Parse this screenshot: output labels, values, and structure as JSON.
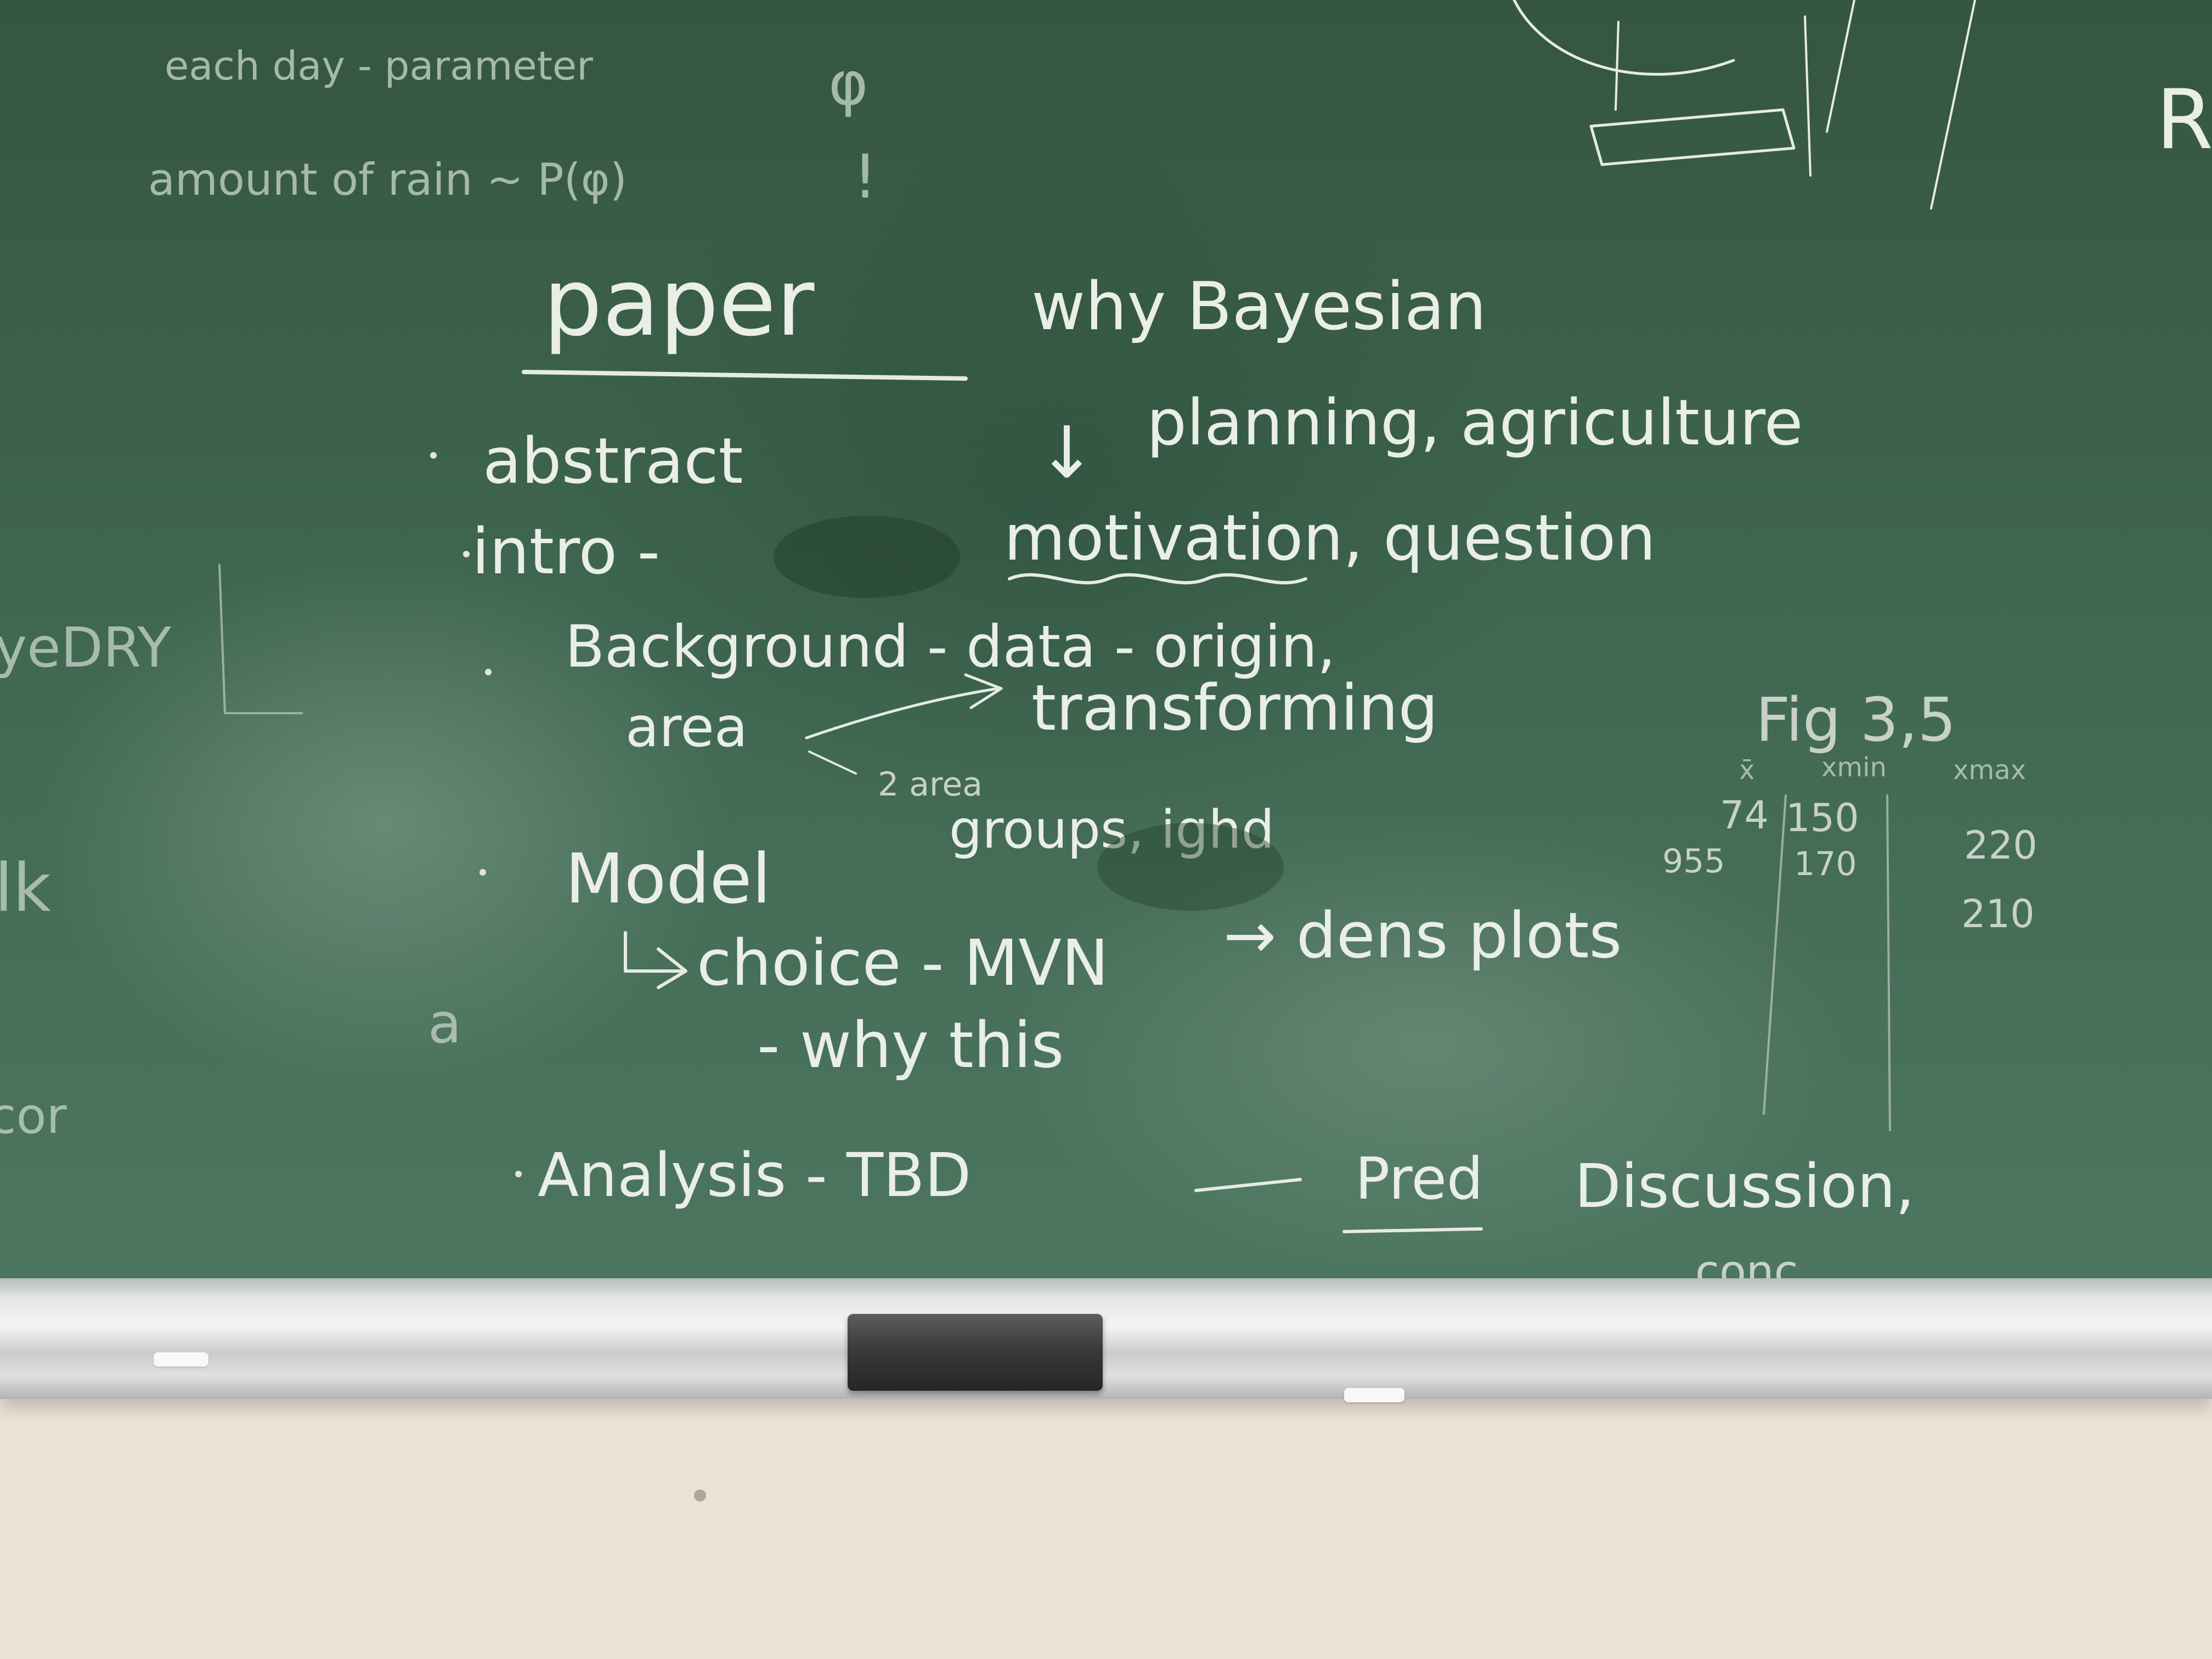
{
  "board": {
    "top_left_notes": {
      "line1": "each day - parameter",
      "line1_symbol": "φ",
      "line2": "amount of rain ~ P(φ)",
      "line2_mark": "!"
    },
    "paper_heading": "paper",
    "why_heading": "why Bayesian",
    "why_arrow": "↓",
    "planning": "planning, agriculture",
    "outline": {
      "abstract": "abstract",
      "intro": "intro -",
      "motivation": "motivation, question",
      "background": "Background - data - origin,",
      "area": "area",
      "transforming": "transforming",
      "two_area": "2 area",
      "groups": "groups, ighd",
      "model": "Model",
      "choice": "choice - MVN",
      "dens_plots": "→ dens plots",
      "why_this": "- why this",
      "analysis": "Analysis - TBD",
      "pred": "Pred",
      "discussion": "Discussion,",
      "conc": "conc"
    },
    "table": {
      "heading": "Fig 3,5",
      "col_headers": [
        "x̄",
        "xmin",
        "xmax"
      ],
      "rows": [
        [
          "74",
          "150",
          "220"
        ],
        [
          "955",
          "170",
          "210"
        ]
      ]
    },
    "left_edge_fragments": [
      "yeDRY",
      "lk",
      "a",
      "cor"
    ],
    "top_right_fragments": [
      "R",
      "/"
    ]
  }
}
